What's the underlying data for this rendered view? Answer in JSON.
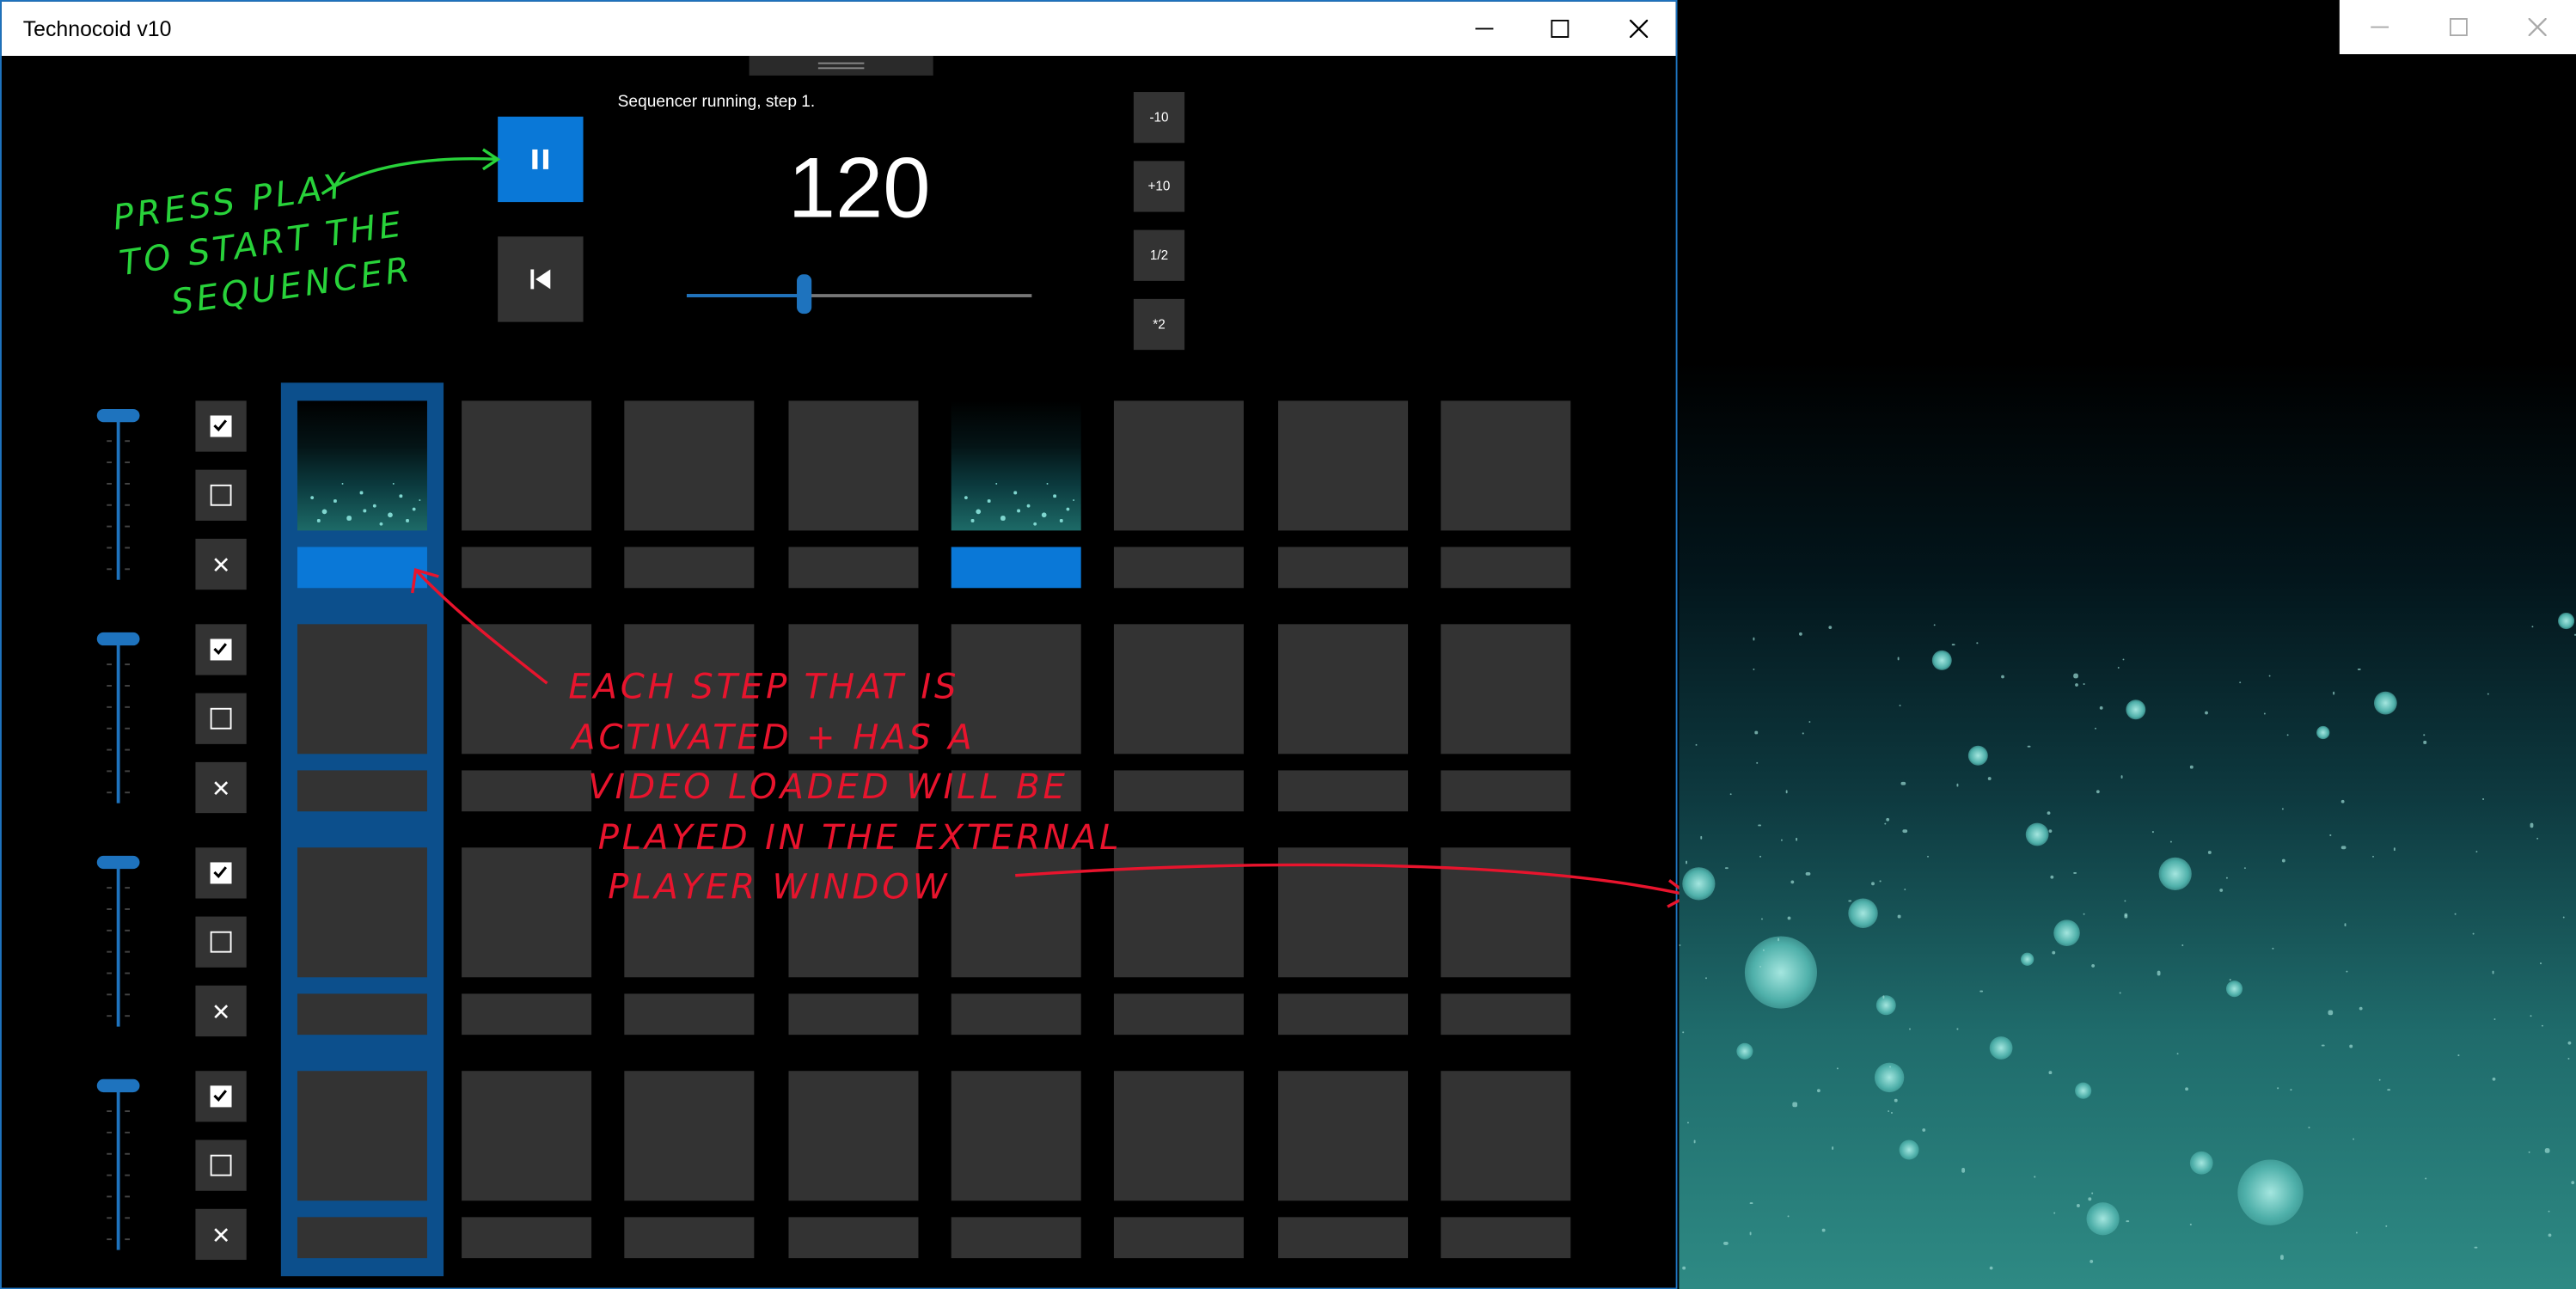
{
  "main_window": {
    "title": "Technocoid v10",
    "caption_buttons": [
      "minimize",
      "maximize",
      "close"
    ]
  },
  "transport": {
    "status": "Sequencer running, step 1.",
    "bpm": "120",
    "tempo_slider_fraction": 0.34,
    "play_state": "playing",
    "play_icon": "pause-icon",
    "rewind_icon": "skip-to-start-icon",
    "tempo_buttons": [
      "-10",
      "+10",
      "1/2",
      "*2"
    ]
  },
  "channels": [
    {
      "volume": 1.0,
      "enabled": true,
      "loop": false,
      "steps_loaded": [
        true,
        false,
        false,
        false,
        true,
        false,
        false,
        false
      ],
      "steps_active": [
        true,
        false,
        false,
        false,
        true,
        false,
        false,
        false
      ]
    },
    {
      "volume": 1.0,
      "enabled": true,
      "loop": false,
      "steps_loaded": [
        false,
        false,
        false,
        false,
        false,
        false,
        false,
        false
      ],
      "steps_active": [
        false,
        false,
        false,
        false,
        false,
        false,
        false,
        false
      ]
    },
    {
      "volume": 1.0,
      "enabled": true,
      "loop": false,
      "steps_loaded": [
        false,
        false,
        false,
        false,
        false,
        false,
        false,
        false
      ],
      "steps_active": [
        false,
        false,
        false,
        false,
        false,
        false,
        false,
        false
      ]
    },
    {
      "volume": 1.0,
      "enabled": true,
      "loop": false,
      "steps_loaded": [
        false,
        false,
        false,
        false,
        false,
        false,
        false,
        false
      ],
      "steps_active": [
        false,
        false,
        false,
        false,
        false,
        false,
        false,
        false
      ]
    }
  ],
  "current_step": 1,
  "annotations": {
    "play_hint": [
      "PRESS PLAY",
      "TO START THE",
      "SEQUENCER"
    ],
    "step_hint": [
      "EACH STEP THAT IS",
      "ACTIVATED + HAS A",
      "VIDEO LOADED WILL BE",
      "PLAYED IN THE EXTERNAL",
      "PLAYER WINDOW"
    ],
    "hint_colors": {
      "green": "#28d23a",
      "red": "#e8142d"
    }
  },
  "player_window": {
    "caption_buttons": [
      "minimize",
      "maximize",
      "close"
    ]
  },
  "colors": {
    "accent": "#0a78d7",
    "cell": "#333333",
    "highlight": "#0c4f8c"
  }
}
